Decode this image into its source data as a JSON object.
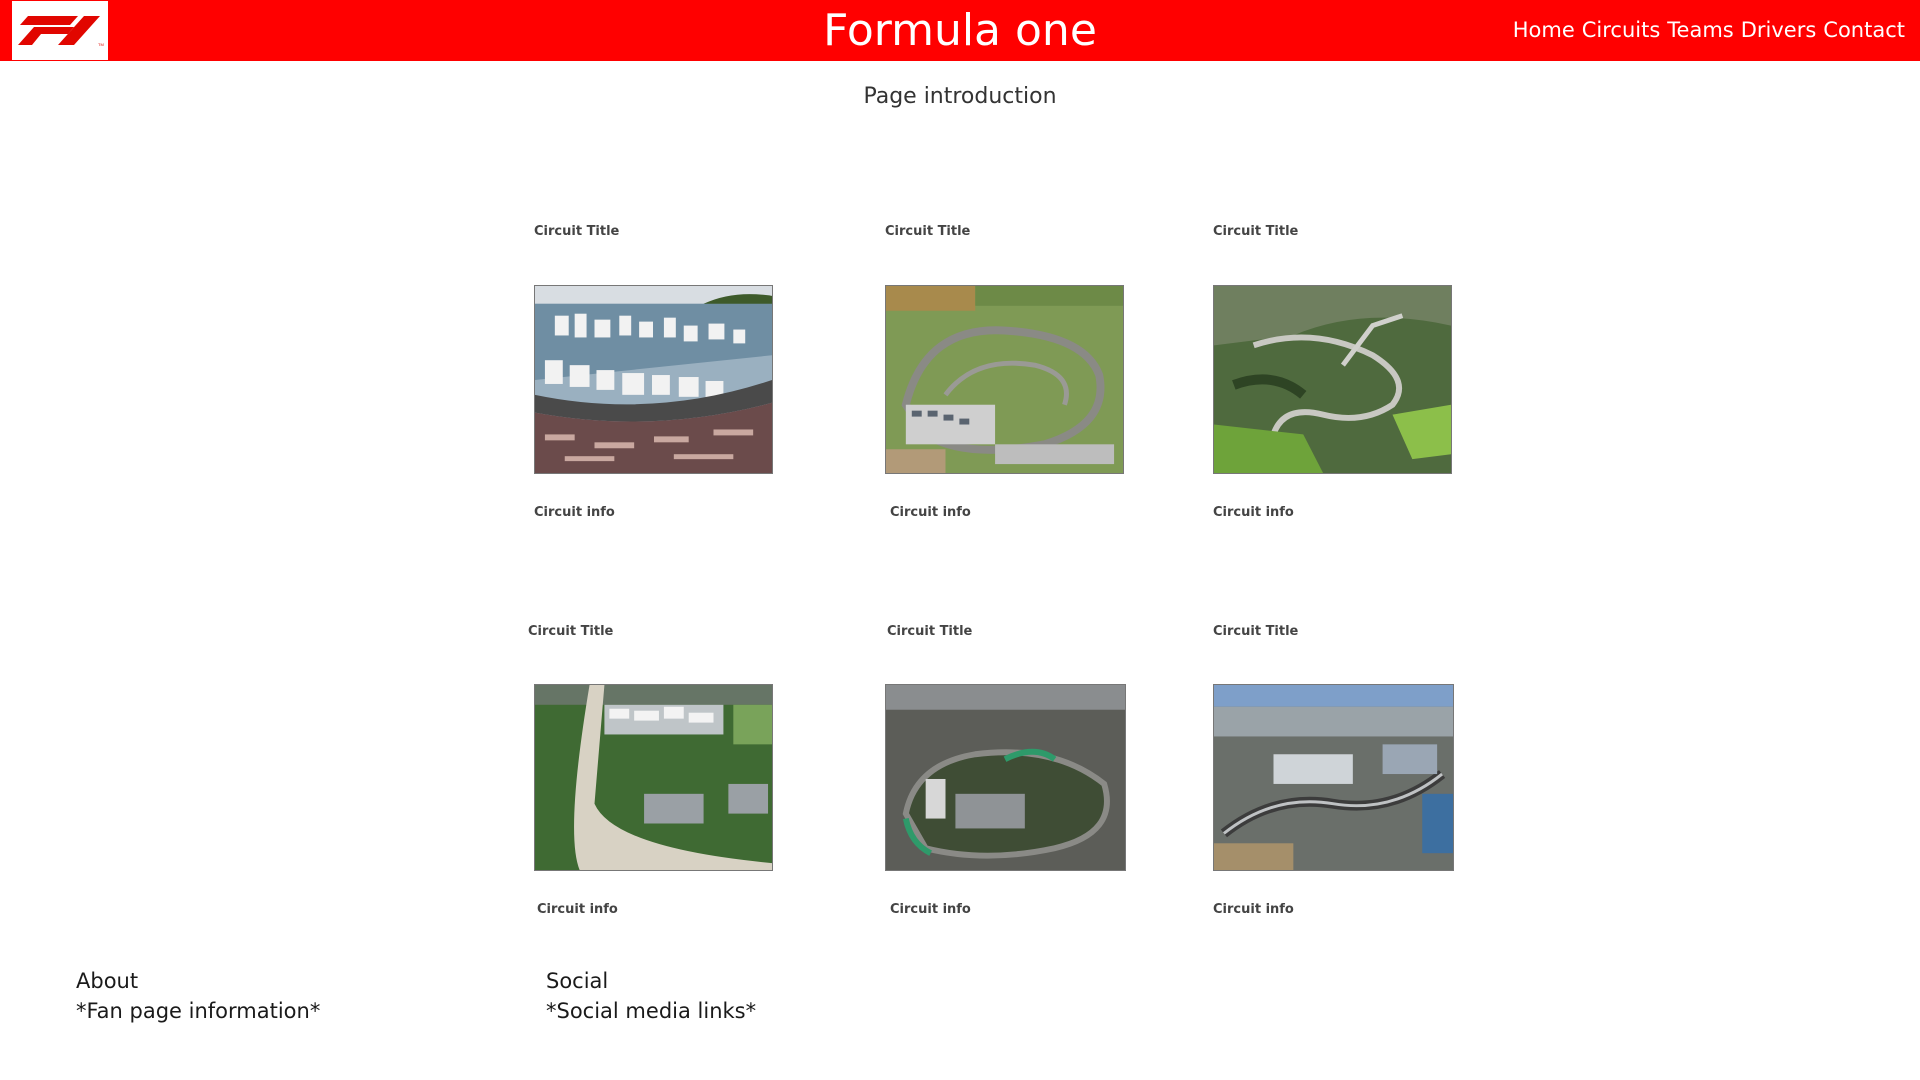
{
  "header": {
    "logo_icon": "f1-logo-icon",
    "title": "Formula one",
    "nav": [
      "Home",
      "Circuits",
      "Teams",
      "Drivers",
      "Contact"
    ]
  },
  "main": {
    "intro": "Page introduction",
    "cards": [
      {
        "title": "Circuit Title",
        "info": "Circuit info",
        "image": "monaco-harbour-aerial"
      },
      {
        "title": "Circuit Title",
        "info": "Circuit info",
        "image": "silverstone-aerial"
      },
      {
        "title": "Circuit Title",
        "info": "Circuit info",
        "image": "spa-forest-aerial"
      },
      {
        "title": "Circuit Title",
        "info": "Circuit info",
        "image": "monza-aerial"
      },
      {
        "title": "Circuit Title",
        "info": "Circuit info",
        "image": "interlagos-aerial"
      },
      {
        "title": "Circuit Title",
        "info": "Circuit info",
        "image": "sochi-coastal-aerial"
      }
    ]
  },
  "footer": {
    "about_heading": "About",
    "about_text": "*Fan page information*",
    "social_heading": "Social",
    "social_text": "*Social media links*"
  },
  "colors": {
    "brand": "#ff0000",
    "header_text": "#ffffff"
  }
}
